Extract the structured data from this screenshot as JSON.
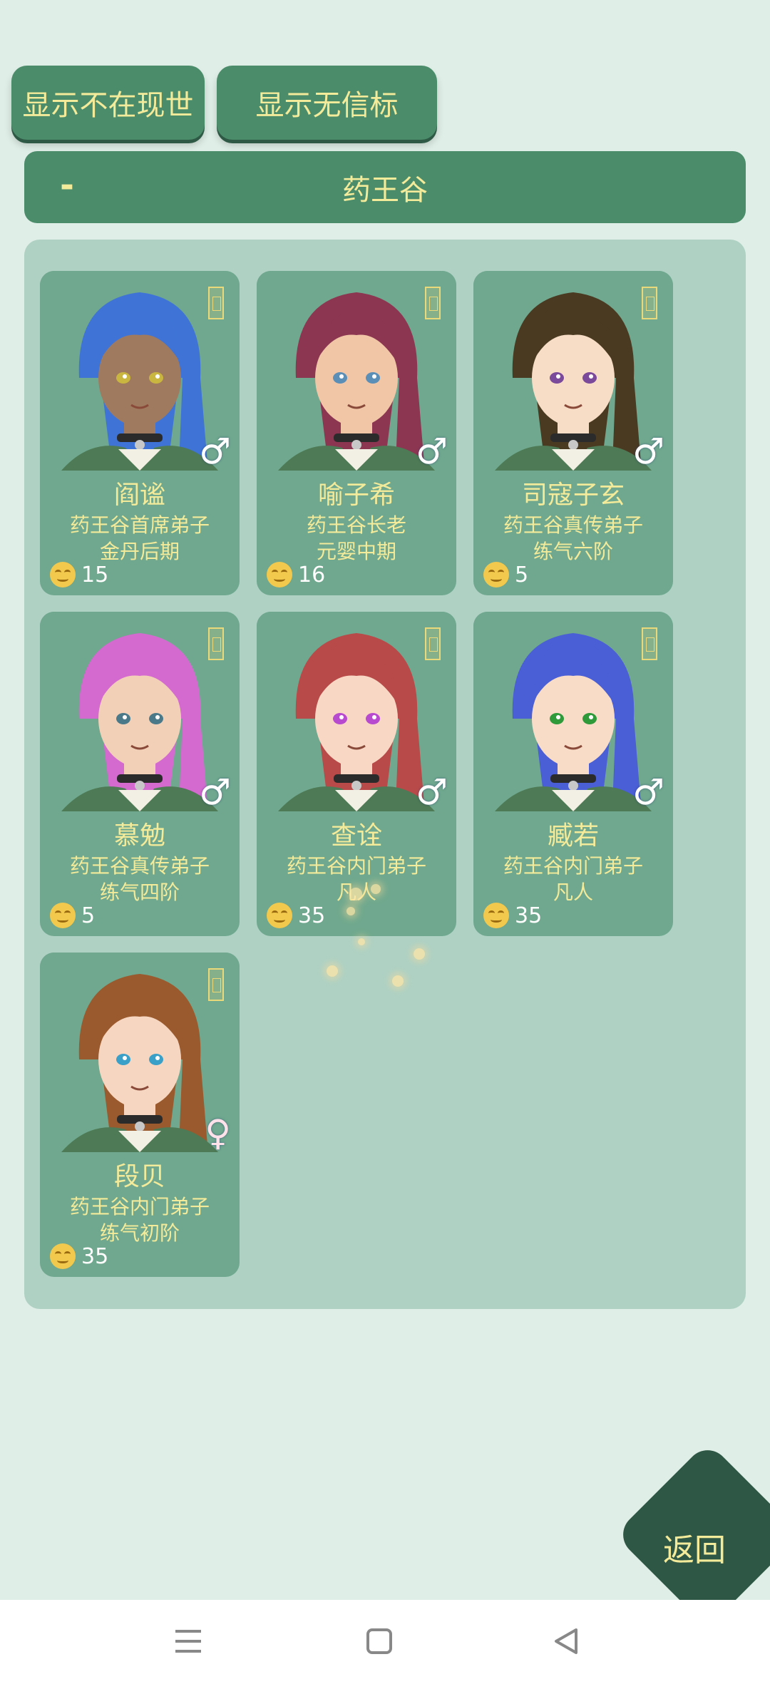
{
  "filters": {
    "show_absent_label": "显示不在现世",
    "show_no_beacon_label": "显示无信标"
  },
  "section": {
    "collapse_symbol": "-",
    "title": "药王谷"
  },
  "cards": [
    {
      "name": "阎谧",
      "title": "药王谷首席弟子",
      "realm": "金丹后期",
      "mood": "15",
      "gender": "♂",
      "hair": "#3f74d6",
      "skin": "#a07a5e",
      "eyes": "#c9b640"
    },
    {
      "name": "喻子希",
      "title": "药王谷长老",
      "realm": "元婴中期",
      "mood": "16",
      "gender": "♂",
      "hair": "#8c3652",
      "skin": "#f0c6a6",
      "eyes": "#5b8fb8"
    },
    {
      "name": "司寇子玄",
      "title": "药王谷真传弟子",
      "realm": "练气六阶",
      "mood": "5",
      "gender": "♂",
      "hair": "#4a3a22",
      "skin": "#f7dcc6",
      "eyes": "#7b4a9a"
    },
    {
      "name": "慕勉",
      "title": "药王谷真传弟子",
      "realm": "练气四阶",
      "mood": "5",
      "gender": "♂",
      "hair": "#d46ad0",
      "skin": "#f2d0b8",
      "eyes": "#4a7a8a"
    },
    {
      "name": "查诠",
      "title": "药王谷内门弟子",
      "realm": "凡人",
      "mood": "35",
      "gender": "♂",
      "hair": "#b84a4a",
      "skin": "#f8d8c4",
      "eyes": "#b84ad0"
    },
    {
      "name": "臧若",
      "title": "药王谷内门弟子",
      "realm": "凡人",
      "mood": "35",
      "gender": "♂",
      "hair": "#4a5ed6",
      "skin": "#f8dcc8",
      "eyes": "#2e9a3a"
    },
    {
      "name": "段贝",
      "title": "药王谷内门弟子",
      "realm": "练气初阶",
      "mood": "35",
      "gender": "♀",
      "hair": "#9a5a2e",
      "skin": "#f6d6c0",
      "eyes": "#3aa0c8"
    }
  ],
  "back_label": "返回",
  "icons": {
    "mood": "smile-face-icon",
    "talisman": "talisman-icon",
    "nav_menu": "menu-lines-icon",
    "nav_home": "square-home-icon",
    "nav_back": "triangle-back-icon"
  },
  "colors": {
    "background": "#dfeee7",
    "button": "#4b8c6b",
    "panel": "#aed1c4",
    "card": "#6fa88e",
    "text_gold": "#f3ea9a",
    "back_button": "#2f5745"
  }
}
